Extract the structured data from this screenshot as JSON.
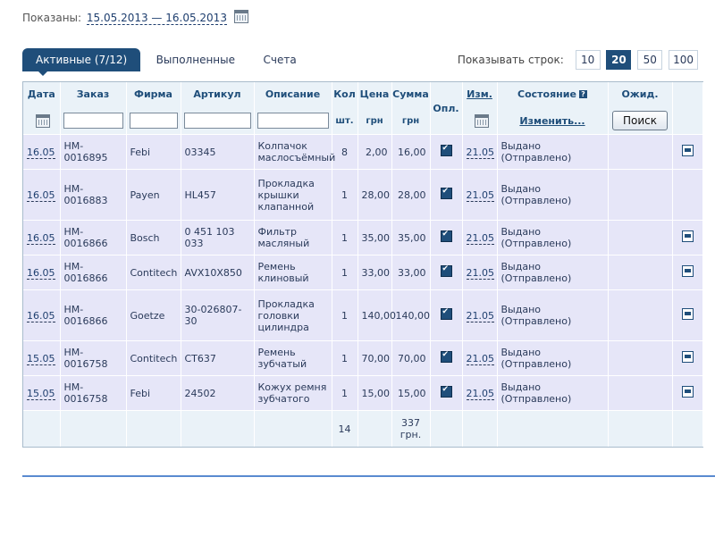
{
  "period": {
    "label": "Показаны:",
    "dates": "15.05.2013 — 16.05.2013",
    "icon": "calendar-icon"
  },
  "tabs": [
    {
      "label": "Активные (7/12)",
      "active": true
    },
    {
      "label": "Выполненные",
      "active": false
    },
    {
      "label": "Счета",
      "active": false
    }
  ],
  "rows_per_page": {
    "label": "Показывать строк:",
    "options": [
      "10",
      "20",
      "50",
      "100"
    ],
    "selected": "20"
  },
  "headers": {
    "date": "Дата",
    "order": "Заказ",
    "brand": "Фирма",
    "article": "Артикул",
    "description": "Описание",
    "qty": "Кол",
    "qty_unit": "шт.",
    "price": "Цена",
    "price_unit": "грн",
    "sum": "Сумма",
    "sum_unit": "грн",
    "paid": "Опл.",
    "changed": "Изм.",
    "state": "Состояние",
    "state_link": "Изменить...",
    "expected": "Ожид.",
    "search_button": "Поиск"
  },
  "rows": [
    {
      "date": "16.05",
      "order": "HM-0016895",
      "brand": "Febi",
      "article": "03345",
      "description": "Колпачок маслосъёмный",
      "qty": "8",
      "price": "2,00",
      "sum": "16,00",
      "changed": "21.05",
      "state": "Выдано (Отправлено)",
      "print": true
    },
    {
      "date": "16.05",
      "order": "HM-0016883",
      "brand": "Payen",
      "article": "HL457",
      "description": "Прокладка крышки клапанной",
      "qty": "1",
      "price": "28,00",
      "sum": "28,00",
      "changed": "21.05",
      "state": "Выдано (Отправлено)",
      "print": false
    },
    {
      "date": "16.05",
      "order": "HM-0016866",
      "brand": "Bosch",
      "article": "0 451 103 033",
      "description": "Фильтр масляный",
      "qty": "1",
      "price": "35,00",
      "sum": "35,00",
      "changed": "21.05",
      "state": "Выдано (Отправлено)",
      "print": true
    },
    {
      "date": "16.05",
      "order": "HM-0016866",
      "brand": "Contitech",
      "article": "AVX10X850",
      "description": "Ремень клиновый",
      "qty": "1",
      "price": "33,00",
      "sum": "33,00",
      "changed": "21.05",
      "state": "Выдано (Отправлено)",
      "print": true
    },
    {
      "date": "16.05",
      "order": "HM-0016866",
      "brand": "Goetze",
      "article": "30-026807-30",
      "description": "Прокладка головки цилиндра",
      "qty": "1",
      "price": "140,00",
      "sum": "140,00",
      "changed": "21.05",
      "state": "Выдано (Отправлено)",
      "print": true
    },
    {
      "date": "15.05",
      "order": "HM-0016758",
      "brand": "Contitech",
      "article": "CT637",
      "description": "Ремень зубчатый",
      "qty": "1",
      "price": "70,00",
      "sum": "70,00",
      "changed": "21.05",
      "state": "Выдано (Отправлено)",
      "print": true
    },
    {
      "date": "15.05",
      "order": "HM-0016758",
      "brand": "Febi",
      "article": "24502",
      "description": "Кожух ремня зубчатого",
      "qty": "1",
      "price": "15,00",
      "sum": "15,00",
      "changed": "21.05",
      "state": "Выдано (Отправлено)",
      "print": true
    }
  ],
  "totals": {
    "qty": "14",
    "sum": "337 грн."
  }
}
